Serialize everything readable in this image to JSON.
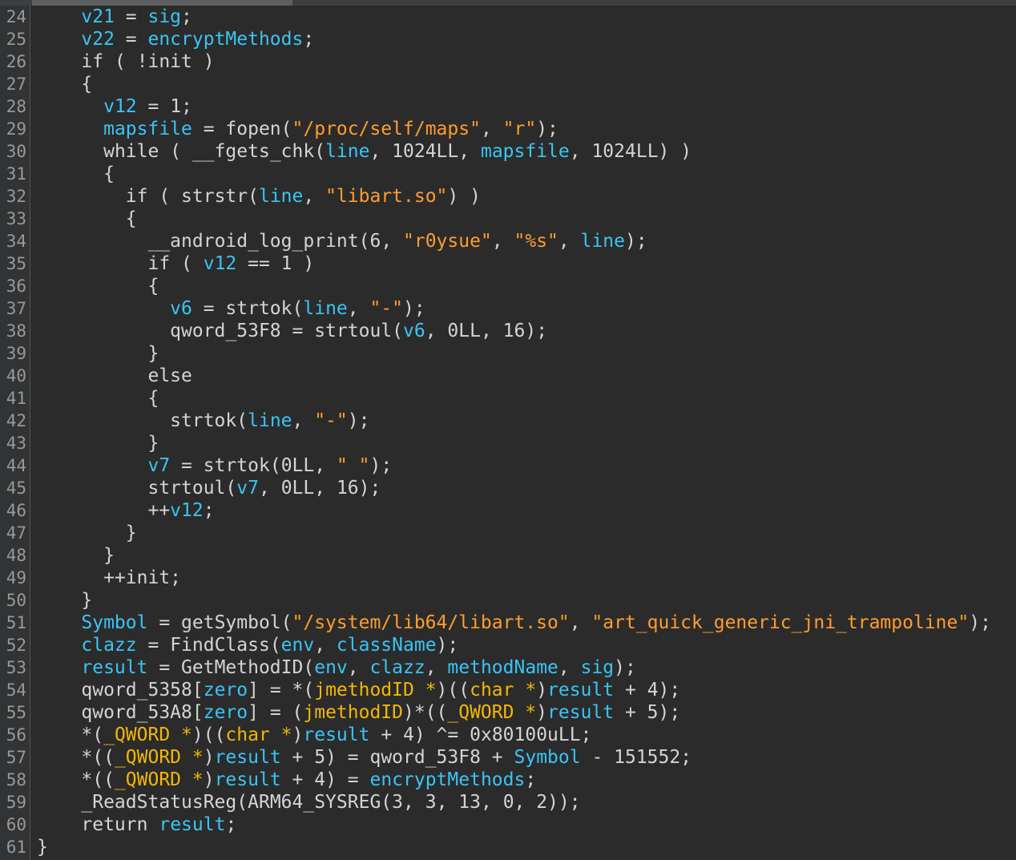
{
  "editor": {
    "lines": [
      {
        "number": "24",
        "tokens": [
          [
            "    ",
            "pl"
          ],
          [
            "v21",
            "var"
          ],
          [
            " = ",
            "op"
          ],
          [
            "sig",
            "var"
          ],
          [
            ";",
            "op"
          ]
        ]
      },
      {
        "number": "25",
        "tokens": [
          [
            "    ",
            "pl"
          ],
          [
            "v22",
            "var"
          ],
          [
            " = ",
            "op"
          ],
          [
            "encryptMethods",
            "var"
          ],
          [
            ";",
            "op"
          ]
        ]
      },
      {
        "number": "26",
        "tokens": [
          [
            "    ",
            "pl"
          ],
          [
            "if",
            "kw"
          ],
          [
            " ( !",
            "op"
          ],
          [
            "init",
            "pl"
          ],
          [
            " )",
            "op"
          ]
        ]
      },
      {
        "number": "27",
        "tokens": [
          [
            "    {",
            "op"
          ]
        ]
      },
      {
        "number": "28",
        "tokens": [
          [
            "      ",
            "pl"
          ],
          [
            "v12",
            "var"
          ],
          [
            " = ",
            "op"
          ],
          [
            "1",
            "num"
          ],
          [
            ";",
            "op"
          ]
        ]
      },
      {
        "number": "29",
        "tokens": [
          [
            "      ",
            "pl"
          ],
          [
            "mapsfile",
            "var"
          ],
          [
            " = ",
            "op"
          ],
          [
            "fopen",
            "fn"
          ],
          [
            "(",
            "op"
          ],
          [
            "\"/proc/self/maps\"",
            "str"
          ],
          [
            ", ",
            "op"
          ],
          [
            "\"r\"",
            "str"
          ],
          [
            ");",
            "op"
          ]
        ]
      },
      {
        "number": "30",
        "tokens": [
          [
            "      ",
            "pl"
          ],
          [
            "while",
            "kw"
          ],
          [
            " ( ",
            "op"
          ],
          [
            "__fgets_chk",
            "fn"
          ],
          [
            "(",
            "op"
          ],
          [
            "line",
            "var"
          ],
          [
            ", ",
            "op"
          ],
          [
            "1024LL",
            "num"
          ],
          [
            ", ",
            "op"
          ],
          [
            "mapsfile",
            "var"
          ],
          [
            ", ",
            "op"
          ],
          [
            "1024LL",
            "num"
          ],
          [
            ") )",
            "op"
          ]
        ]
      },
      {
        "number": "31",
        "tokens": [
          [
            "      {",
            "op"
          ]
        ]
      },
      {
        "number": "32",
        "tokens": [
          [
            "        ",
            "pl"
          ],
          [
            "if",
            "kw"
          ],
          [
            " ( ",
            "op"
          ],
          [
            "strstr",
            "fn"
          ],
          [
            "(",
            "op"
          ],
          [
            "line",
            "var"
          ],
          [
            ", ",
            "op"
          ],
          [
            "\"libart.so\"",
            "str"
          ],
          [
            ") )",
            "op"
          ]
        ]
      },
      {
        "number": "33",
        "tokens": [
          [
            "        {",
            "op"
          ]
        ]
      },
      {
        "number": "34",
        "tokens": [
          [
            "          ",
            "pl"
          ],
          [
            "__android_log_print",
            "fn"
          ],
          [
            "(",
            "op"
          ],
          [
            "6",
            "num"
          ],
          [
            ", ",
            "op"
          ],
          [
            "\"r0ysue\"",
            "str"
          ],
          [
            ", ",
            "op"
          ],
          [
            "\"%s\"",
            "str"
          ],
          [
            ", ",
            "op"
          ],
          [
            "line",
            "var"
          ],
          [
            ");",
            "op"
          ]
        ]
      },
      {
        "number": "35",
        "tokens": [
          [
            "          ",
            "pl"
          ],
          [
            "if",
            "kw"
          ],
          [
            " ( ",
            "op"
          ],
          [
            "v12",
            "var"
          ],
          [
            " == ",
            "op"
          ],
          [
            "1",
            "num"
          ],
          [
            " )",
            "op"
          ]
        ]
      },
      {
        "number": "36",
        "tokens": [
          [
            "          {",
            "op"
          ]
        ]
      },
      {
        "number": "37",
        "tokens": [
          [
            "            ",
            "pl"
          ],
          [
            "v6",
            "var"
          ],
          [
            " = ",
            "op"
          ],
          [
            "strtok",
            "fn"
          ],
          [
            "(",
            "op"
          ],
          [
            "line",
            "var"
          ],
          [
            ", ",
            "op"
          ],
          [
            "\"-\"",
            "str"
          ],
          [
            ");",
            "op"
          ]
        ]
      },
      {
        "number": "38",
        "tokens": [
          [
            "            ",
            "pl"
          ],
          [
            "qword_53F8",
            "pl"
          ],
          [
            " = ",
            "op"
          ],
          [
            "strtoul",
            "fn"
          ],
          [
            "(",
            "op"
          ],
          [
            "v6",
            "var"
          ],
          [
            ", ",
            "op"
          ],
          [
            "0LL",
            "num"
          ],
          [
            ", ",
            "op"
          ],
          [
            "16",
            "num"
          ],
          [
            ");",
            "op"
          ]
        ]
      },
      {
        "number": "39",
        "tokens": [
          [
            "          }",
            "op"
          ]
        ]
      },
      {
        "number": "40",
        "tokens": [
          [
            "          ",
            "pl"
          ],
          [
            "else",
            "kw"
          ]
        ]
      },
      {
        "number": "41",
        "tokens": [
          [
            "          {",
            "op"
          ]
        ]
      },
      {
        "number": "42",
        "tokens": [
          [
            "            ",
            "pl"
          ],
          [
            "strtok",
            "fn"
          ],
          [
            "(",
            "op"
          ],
          [
            "line",
            "var"
          ],
          [
            ", ",
            "op"
          ],
          [
            "\"-\"",
            "str"
          ],
          [
            ");",
            "op"
          ]
        ]
      },
      {
        "number": "43",
        "tokens": [
          [
            "          }",
            "op"
          ]
        ]
      },
      {
        "number": "44",
        "tokens": [
          [
            "          ",
            "pl"
          ],
          [
            "v7",
            "var"
          ],
          [
            " = ",
            "op"
          ],
          [
            "strtok",
            "fn"
          ],
          [
            "(",
            "op"
          ],
          [
            "0LL",
            "num"
          ],
          [
            ", ",
            "op"
          ],
          [
            "\" \"",
            "str"
          ],
          [
            ");",
            "op"
          ]
        ]
      },
      {
        "number": "45",
        "tokens": [
          [
            "          ",
            "pl"
          ],
          [
            "strtoul",
            "fn"
          ],
          [
            "(",
            "op"
          ],
          [
            "v7",
            "var"
          ],
          [
            ", ",
            "op"
          ],
          [
            "0LL",
            "num"
          ],
          [
            ", ",
            "op"
          ],
          [
            "16",
            "num"
          ],
          [
            ");",
            "op"
          ]
        ]
      },
      {
        "number": "46",
        "tokens": [
          [
            "          ++",
            "op"
          ],
          [
            "v12",
            "var"
          ],
          [
            ";",
            "op"
          ]
        ]
      },
      {
        "number": "47",
        "tokens": [
          [
            "        }",
            "op"
          ]
        ]
      },
      {
        "number": "48",
        "tokens": [
          [
            "      }",
            "op"
          ]
        ]
      },
      {
        "number": "49",
        "tokens": [
          [
            "      ++",
            "op"
          ],
          [
            "init",
            "pl"
          ],
          [
            ";",
            "op"
          ]
        ]
      },
      {
        "number": "50",
        "tokens": [
          [
            "    }",
            "op"
          ]
        ]
      },
      {
        "number": "51",
        "tokens": [
          [
            "    ",
            "pl"
          ],
          [
            "Symbol",
            "var"
          ],
          [
            " = ",
            "op"
          ],
          [
            "getSymbol",
            "fn"
          ],
          [
            "(",
            "op"
          ],
          [
            "\"/system/lib64/libart.so\"",
            "str"
          ],
          [
            ", ",
            "op"
          ],
          [
            "\"art_quick_generic_jni_trampoline\"",
            "str"
          ],
          [
            ");",
            "op"
          ]
        ]
      },
      {
        "number": "52",
        "tokens": [
          [
            "    ",
            "pl"
          ],
          [
            "clazz",
            "var"
          ],
          [
            " = ",
            "op"
          ],
          [
            "FindClass",
            "fn"
          ],
          [
            "(",
            "op"
          ],
          [
            "env",
            "var"
          ],
          [
            ", ",
            "op"
          ],
          [
            "className",
            "var"
          ],
          [
            ");",
            "op"
          ]
        ]
      },
      {
        "number": "53",
        "tokens": [
          [
            "    ",
            "pl"
          ],
          [
            "result",
            "var"
          ],
          [
            " = ",
            "op"
          ],
          [
            "GetMethodID",
            "fn"
          ],
          [
            "(",
            "op"
          ],
          [
            "env",
            "var"
          ],
          [
            ", ",
            "op"
          ],
          [
            "clazz",
            "var"
          ],
          [
            ", ",
            "op"
          ],
          [
            "methodName",
            "var"
          ],
          [
            ", ",
            "op"
          ],
          [
            "sig",
            "var"
          ],
          [
            ");",
            "op"
          ]
        ]
      },
      {
        "number": "54",
        "tokens": [
          [
            "    ",
            "pl"
          ],
          [
            "qword_5358",
            "pl"
          ],
          [
            "[",
            "op"
          ],
          [
            "zero",
            "var"
          ],
          [
            "] = *(",
            "op"
          ],
          [
            "jmethodID *",
            "type"
          ],
          [
            ")((",
            "op"
          ],
          [
            "char *",
            "type"
          ],
          [
            ")",
            "op"
          ],
          [
            "result",
            "var"
          ],
          [
            " + ",
            "op"
          ],
          [
            "4",
            "num"
          ],
          [
            ");",
            "op"
          ]
        ]
      },
      {
        "number": "55",
        "tokens": [
          [
            "    ",
            "pl"
          ],
          [
            "qword_53A8",
            "pl"
          ],
          [
            "[",
            "op"
          ],
          [
            "zero",
            "var"
          ],
          [
            "] = (",
            "op"
          ],
          [
            "jmethodID",
            "type"
          ],
          [
            ")*((",
            "op"
          ],
          [
            "_QWORD *",
            "type"
          ],
          [
            ")",
            "op"
          ],
          [
            "result",
            "var"
          ],
          [
            " + ",
            "op"
          ],
          [
            "5",
            "num"
          ],
          [
            ");",
            "op"
          ]
        ]
      },
      {
        "number": "56",
        "tokens": [
          [
            "    *(",
            "op"
          ],
          [
            "_QWORD *",
            "type"
          ],
          [
            ")((",
            "op"
          ],
          [
            "char *",
            "type"
          ],
          [
            ")",
            "op"
          ],
          [
            "result",
            "var"
          ],
          [
            " + ",
            "op"
          ],
          [
            "4",
            "num"
          ],
          [
            ") ^= ",
            "op"
          ],
          [
            "0x80100uLL",
            "num"
          ],
          [
            ";",
            "op"
          ]
        ]
      },
      {
        "number": "57",
        "tokens": [
          [
            "    *((",
            "op"
          ],
          [
            "_QWORD *",
            "type"
          ],
          [
            ")",
            "op"
          ],
          [
            "result",
            "var"
          ],
          [
            " + ",
            "op"
          ],
          [
            "5",
            "num"
          ],
          [
            ") = ",
            "op"
          ],
          [
            "qword_53F8",
            "pl"
          ],
          [
            " + ",
            "op"
          ],
          [
            "Symbol",
            "var"
          ],
          [
            " - ",
            "op"
          ],
          [
            "151552",
            "num"
          ],
          [
            ";",
            "op"
          ]
        ]
      },
      {
        "number": "58",
        "tokens": [
          [
            "    *((",
            "op"
          ],
          [
            "_QWORD *",
            "type"
          ],
          [
            ")",
            "op"
          ],
          [
            "result",
            "var"
          ],
          [
            " + ",
            "op"
          ],
          [
            "4",
            "num"
          ],
          [
            ") = ",
            "op"
          ],
          [
            "encryptMethods",
            "var"
          ],
          [
            ";",
            "op"
          ]
        ]
      },
      {
        "number": "59",
        "tokens": [
          [
            "    ",
            "pl"
          ],
          [
            "_ReadStatusReg",
            "fn"
          ],
          [
            "(",
            "op"
          ],
          [
            "ARM64_SYSREG",
            "fn"
          ],
          [
            "(",
            "op"
          ],
          [
            "3",
            "num"
          ],
          [
            ", ",
            "op"
          ],
          [
            "3",
            "num"
          ],
          [
            ", ",
            "op"
          ],
          [
            "13",
            "num"
          ],
          [
            ", ",
            "op"
          ],
          [
            "0",
            "num"
          ],
          [
            ", ",
            "op"
          ],
          [
            "2",
            "num"
          ],
          [
            "));",
            "op"
          ]
        ]
      },
      {
        "number": "60",
        "tokens": [
          [
            "    ",
            "pl"
          ],
          [
            "return",
            "kw"
          ],
          [
            " ",
            "pl"
          ],
          [
            "result",
            "var"
          ],
          [
            ";",
            "op"
          ]
        ]
      },
      {
        "number": "61",
        "tokens": [
          [
            "}",
            "op"
          ]
        ]
      }
    ]
  }
}
